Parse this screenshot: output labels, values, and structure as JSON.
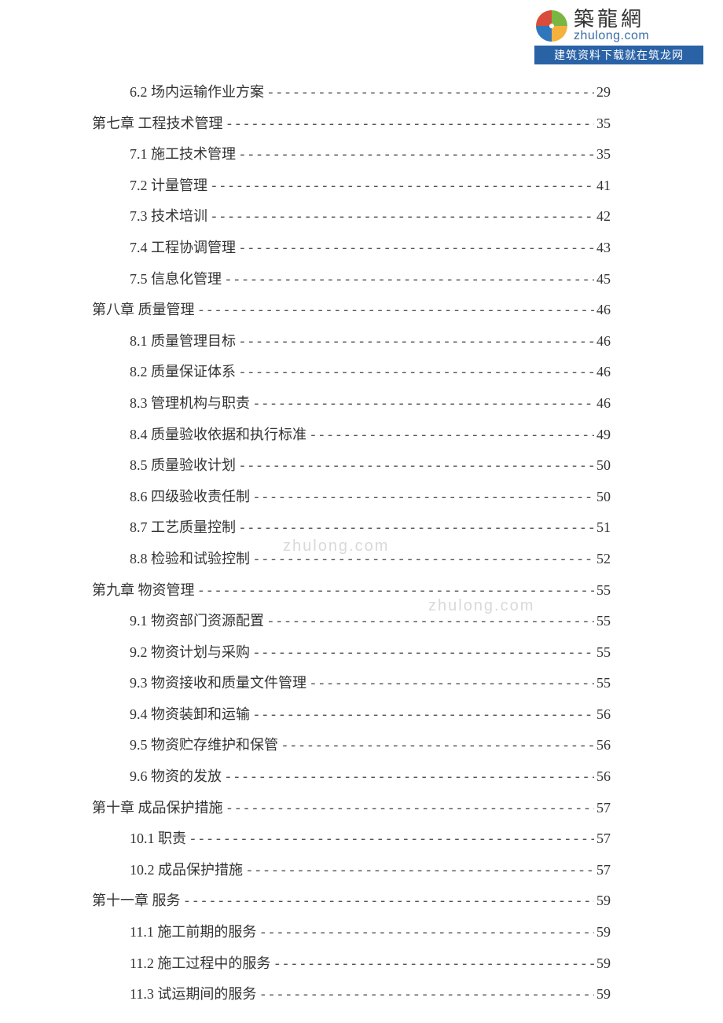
{
  "logo": {
    "cn": "築龍網",
    "en": "zhulong.com",
    "strip": "建筑资料下载就在筑龙网",
    "watermark": "zhulong.com"
  },
  "toc": [
    {
      "type": "section",
      "label": "6.2 场内运输作业方案",
      "page": "29"
    },
    {
      "type": "chapter",
      "label": "第七章 工程技术管理",
      "page": "35"
    },
    {
      "type": "section",
      "label": "7.1 施工技术管理",
      "page": "35"
    },
    {
      "type": "section",
      "label": "7.2 计量管理",
      "page": "41"
    },
    {
      "type": "section",
      "label": "7.3 技术培训",
      "page": "42"
    },
    {
      "type": "section",
      "label": "7.4 工程协调管理",
      "page": "43"
    },
    {
      "type": "section",
      "label": "7.5 信息化管理",
      "page": "45"
    },
    {
      "type": "chapter",
      "label": "第八章 质量管理",
      "page": "46"
    },
    {
      "type": "section",
      "label": "8.1 质量管理目标",
      "page": "46"
    },
    {
      "type": "section",
      "label": "8.2 质量保证体系",
      "page": "46"
    },
    {
      "type": "section",
      "label": "8.3 管理机构与职责",
      "page": "46"
    },
    {
      "type": "section",
      "label": "8.4 质量验收依据和执行标准",
      "page": "49"
    },
    {
      "type": "section",
      "label": "8.5 质量验收计划",
      "page": "50"
    },
    {
      "type": "section",
      "label": "8.6 四级验收责任制",
      "page": "50"
    },
    {
      "type": "section",
      "label": "8.7 工艺质量控制",
      "page": "51"
    },
    {
      "type": "section",
      "label": "8.8 检验和试验控制",
      "page": "52"
    },
    {
      "type": "chapter",
      "label": "第九章 物资管理",
      "page": "55"
    },
    {
      "type": "section",
      "label": "9.1 物资部门资源配置",
      "page": "55"
    },
    {
      "type": "section",
      "label": "9.2 物资计划与采购",
      "page": "55"
    },
    {
      "type": "section",
      "label": "9.3 物资接收和质量文件管理",
      "page": "55"
    },
    {
      "type": "section",
      "label": "9.4 物资装卸和运输",
      "page": "56"
    },
    {
      "type": "section",
      "label": "9.5 物资贮存维护和保管",
      "page": "56"
    },
    {
      "type": "section",
      "label": "9.6 物资的发放",
      "page": "56"
    },
    {
      "type": "chapter",
      "label": "第十章 成品保护措施",
      "page": "57"
    },
    {
      "type": "section",
      "label": "10.1 职责",
      "page": "57"
    },
    {
      "type": "section",
      "label": "10.2 成品保护措施",
      "page": "57"
    },
    {
      "type": "chapter",
      "label": "第十一章 服务",
      "page": "59"
    },
    {
      "type": "section",
      "label": "11.1 施工前期的服务",
      "page": "59"
    },
    {
      "type": "section",
      "label": "11.2 施工过程中的服务",
      "page": "59"
    },
    {
      "type": "section",
      "label": "11.3 试运期间的服务",
      "page": "59"
    }
  ]
}
